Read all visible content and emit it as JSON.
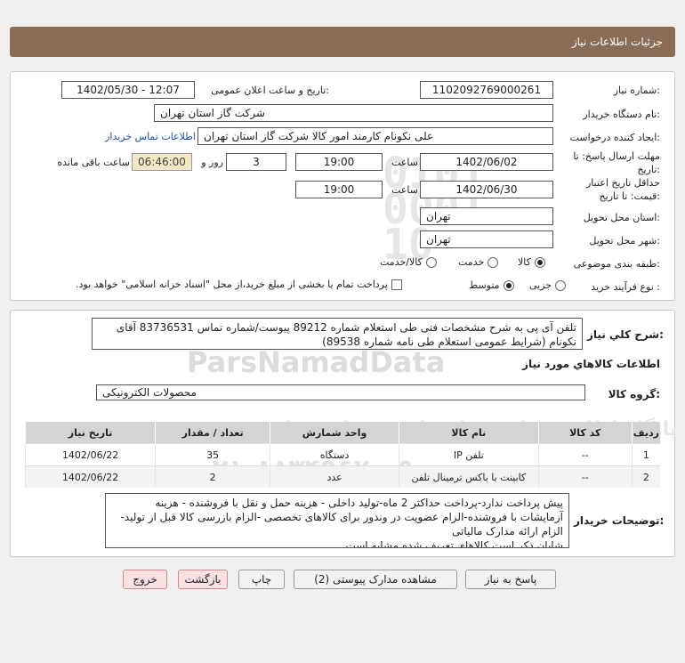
{
  "header": {
    "title": "جزئیات اطلاعات نیاز"
  },
  "form": {
    "need_number_label": "شماره نیاز:",
    "need_number": "1102092769000261",
    "announce_label": "تاریخ و ساعت اعلان عمومی:",
    "announce_value": "1402/05/30 - 12:07",
    "buyer_org_label": "نام دستگاه خریدار:",
    "buyer_org": "شرکت گاز استان تهران",
    "requester_label": "ایجاد کننده درخواست:",
    "requester": "علی نکونام کارمند امور کالا شرکت گاز استان تهران",
    "contact_link": "اطلاعات تماس خریدار",
    "deadline_label_1": "مهلت ارسال پاسخ: تا",
    "deadline_label_2": "تاریخ:",
    "deadline_date": "1402/06/02",
    "time_label": "ساعت",
    "deadline_time": "19:00",
    "days_value": "3",
    "days_label": "روز و",
    "remaining_time": "06:46:00",
    "remaining_label": "ساعت باقی مانده",
    "validity_label_1": "حداقل تاریخ اعتبار",
    "validity_label_2": "قیمت: تا تاریخ:",
    "validity_date": "1402/06/30",
    "validity_time": "19:00",
    "province_label": "استان محل تحویل:",
    "province": "تهران",
    "city_label": "شهر محل تحویل:",
    "city": "تهران",
    "category_label": "طبقه بندی موضوعی:",
    "category_options": [
      "کالا",
      "خدمت",
      "کالا/خدمت"
    ],
    "category_selected": "کالا",
    "process_label": "نوع فرآیند خرید :",
    "process_options": [
      "جزیی",
      "متوسط"
    ],
    "process_selected": "متوسط",
    "payment_note": "پرداخت تمام یا بخشی از مبلغ خرید،از محل \"اسناد خزانه اسلامی\" خواهد بود."
  },
  "need": {
    "summary_label": "شرح کلي نياز:",
    "summary_text": "تلفن آی پی به شرح مشخصات فنی طی استعلام شماره 89212 پیوست/شماره تماس 83736531 آقای نکونام  (شرایط عمومی استعلام طی نامه شماره 89538)",
    "goods_info_title": "اطلاعات کالاهاي مورد نياز",
    "goods_group_label": "گروه کالا:",
    "goods_group": "محصولات الکترونیکی"
  },
  "table": {
    "columns": [
      "ردیف",
      "کد کالا",
      "نام کالا",
      "واحد شمارش",
      "تعداد / مقدار",
      "تاریخ نیاز"
    ],
    "rows": [
      [
        "1",
        "--",
        "تلفن IP",
        "دستگاه",
        "35",
        "1402/06/22"
      ],
      [
        "2",
        "--",
        "کابینت یا باکس ترمینال تلفن",
        "عدد",
        "2",
        "1402/06/22"
      ]
    ]
  },
  "buyer_notes": {
    "label": "توضیحات خریدار:",
    "text": "پیش پرداخت ندارد-پرداخت حداکثر 2 ماه-تولید داخلی - هزینه حمل و نقل با فروشنده - هزینه آزمایشات با فروشنده-الزام عضویت در وندور برای کالاهای تخصصی -الزام بازرسی کالا قبل از تولید-الزام ارائه مدارک مالیاتی\nشایان ذکر است کالاهای تعریف شده مشابه است"
  },
  "buttons": {
    "reply": "پاسخ به نیاز",
    "attachments": "مشاهده مدارک پیوستی (2)",
    "print": "چاپ",
    "back": "بازگشت",
    "exit": "خروج"
  },
  "watermark": {
    "brand": "ParsNamadData",
    "slogan": "پایگاه اطلاع رسانی مناقصات و مزایده ها",
    "phone": "۰۲۱-۸۸۳۴۹۶۷۰-۵"
  }
}
